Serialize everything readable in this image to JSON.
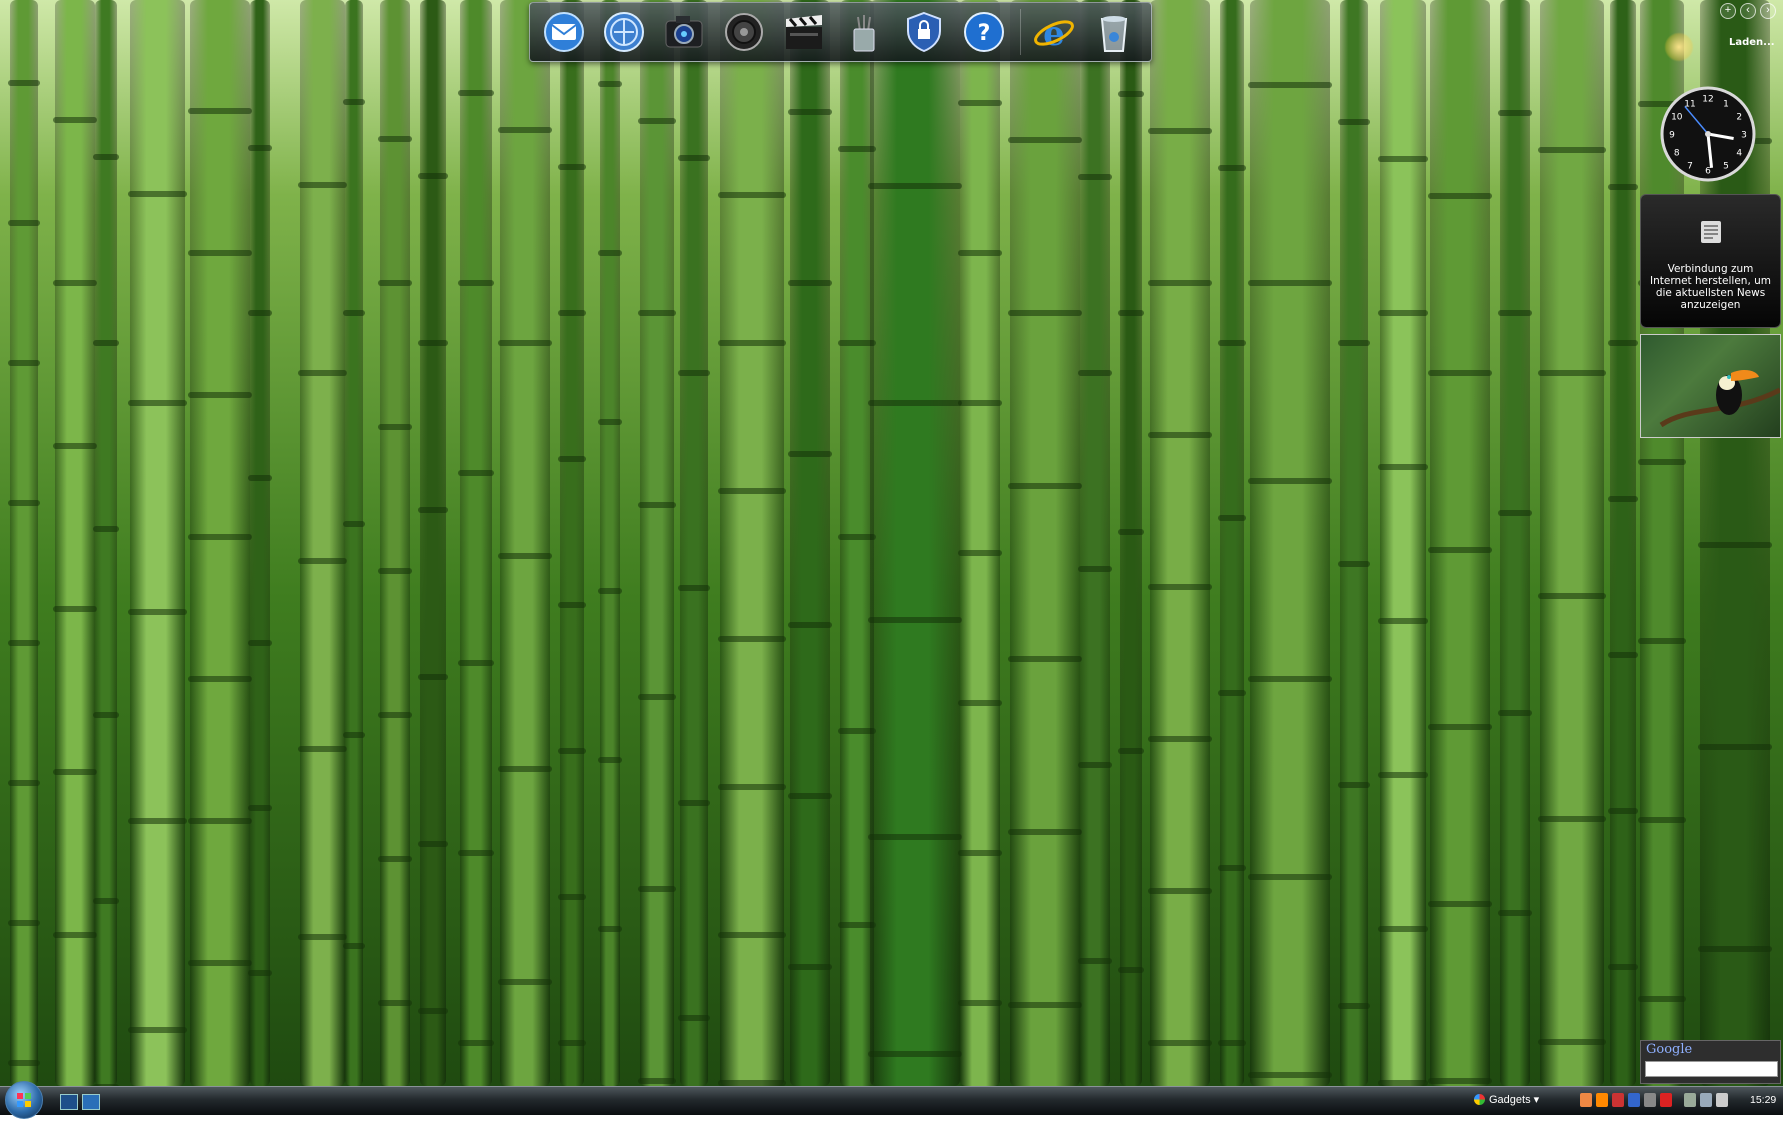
{
  "desktop": {
    "wallpaper": "bamboo-forest",
    "colors": {
      "light": "#cfe8a8",
      "mid": "#3f7d1f",
      "dark": "#1f4a10"
    }
  },
  "dock": {
    "items": [
      {
        "name": "mail-icon"
      },
      {
        "name": "messenger-icon"
      },
      {
        "name": "camera-icon"
      },
      {
        "name": "speaker-icon"
      },
      {
        "name": "clapperboard-icon"
      },
      {
        "name": "pen-cup-icon"
      },
      {
        "name": "security-shield-icon"
      },
      {
        "name": "help-icon"
      },
      {
        "name": "internet-explorer-icon"
      },
      {
        "name": "recycle-bin-icon"
      }
    ]
  },
  "sidebar": {
    "controls": [
      "+",
      "‹",
      "›"
    ],
    "weather": {
      "status": "Laden..."
    },
    "clock": {
      "numbers": [
        "12",
        "1",
        "2",
        "3",
        "4",
        "5",
        "6",
        "7",
        "8",
        "9",
        "10",
        "11"
      ]
    },
    "news": {
      "message": "Verbindung zum Internet herstellen, um die aktuellsten News anzuzeigen"
    },
    "slideshow": {
      "subject": "toucan"
    },
    "google": {
      "logo": "Google",
      "search_value": ""
    }
  },
  "taskbar": {
    "gadgets_label": "Gadgets",
    "clock": "15:29"
  }
}
